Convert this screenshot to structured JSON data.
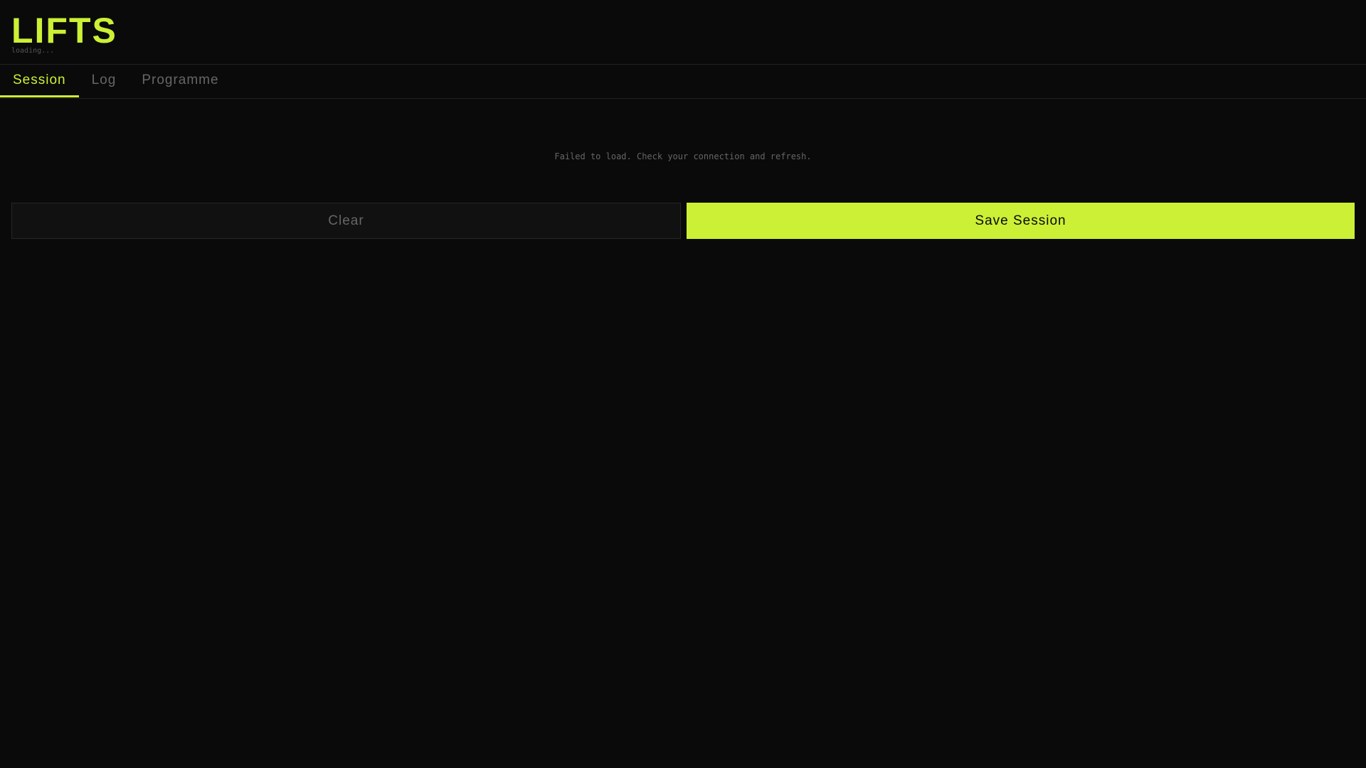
{
  "header": {
    "title": "LIFTS",
    "status": "loading..."
  },
  "tabs": [
    {
      "label": "Session",
      "active": true
    },
    {
      "label": "Log"
    },
    {
      "label": "Programme"
    }
  ],
  "main": {
    "error_message": "Failed to load. Check your connection and refresh.",
    "clear_label": "Clear",
    "save_label": "Save Session"
  },
  "colors": {
    "accent": "#ccf035",
    "background": "#0a0a0a"
  }
}
